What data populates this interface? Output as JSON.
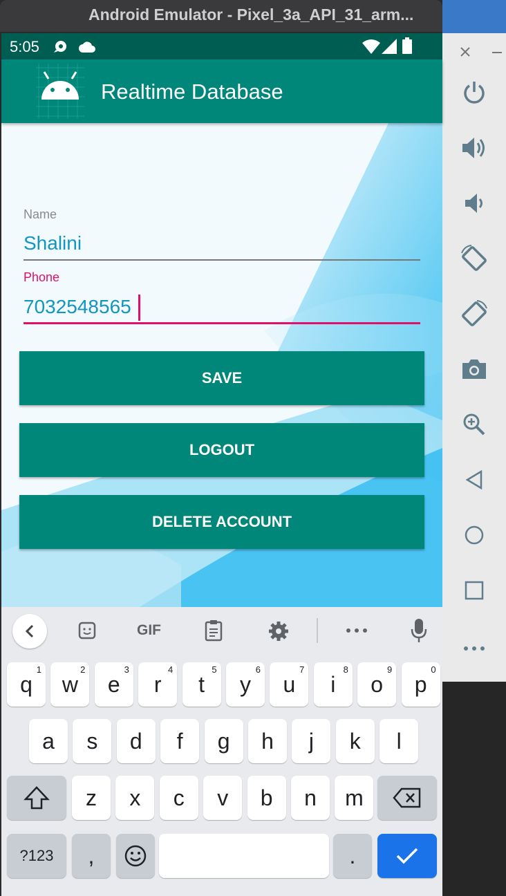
{
  "window": {
    "title": "Android Emulator - Pixel_3a_API_31_arm..."
  },
  "status_bar": {
    "time": "5:05"
  },
  "app_bar": {
    "title": "Realtime Database"
  },
  "form": {
    "name_label": "Name",
    "name_value": "Shalini",
    "phone_label": "Phone",
    "phone_value": "7032548565"
  },
  "buttons": {
    "save": "SAVE",
    "logout": "LOGOUT",
    "delete": "DELETE ACCOUNT"
  },
  "keyboard": {
    "toolbar_gif": "GIF",
    "row1": [
      {
        "k": "q",
        "n": "1"
      },
      {
        "k": "w",
        "n": "2"
      },
      {
        "k": "e",
        "n": "3"
      },
      {
        "k": "r",
        "n": "4"
      },
      {
        "k": "t",
        "n": "5"
      },
      {
        "k": "y",
        "n": "6"
      },
      {
        "k": "u",
        "n": "7"
      },
      {
        "k": "i",
        "n": "8"
      },
      {
        "k": "o",
        "n": "9"
      },
      {
        "k": "p",
        "n": "0"
      }
    ],
    "row2": [
      "a",
      "s",
      "d",
      "f",
      "g",
      "h",
      "j",
      "k",
      "l"
    ],
    "row3": [
      "z",
      "x",
      "c",
      "v",
      "b",
      "n",
      "m"
    ],
    "sym_label": "?123",
    "comma": ",",
    "period": "."
  },
  "colors": {
    "primary": "#00877a",
    "primary_dark": "#005d52",
    "accent": "#e0106a",
    "text_value": "#1295bf",
    "enter_key": "#1a73e8"
  }
}
